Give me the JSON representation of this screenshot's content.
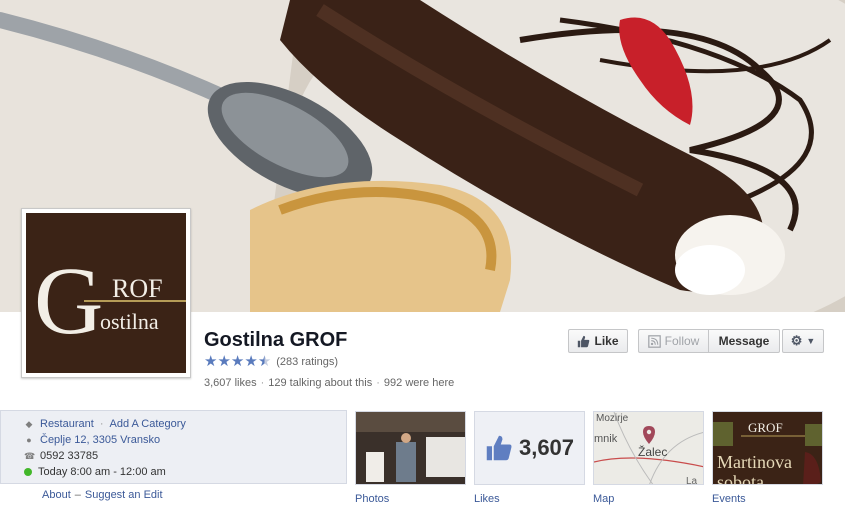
{
  "page": {
    "title": "Gostilna GROF",
    "rating_text": "(283 ratings)",
    "rating_stars": 4.5,
    "stats": {
      "likes": "3,607 likes",
      "talking": "129 talking about this",
      "were_here": "992 were here"
    }
  },
  "logo": {
    "big_letter": "G",
    "rof": "ROF",
    "sub": "ostilna"
  },
  "actions": {
    "like_label": "Like",
    "follow_label": "Follow",
    "message_label": "Message"
  },
  "info": {
    "category": "Restaurant",
    "add_category": "Add A Category",
    "address": "Čeplje 12, 3305 Vransko",
    "phone": "0592 33785",
    "hours": "Today 8:00 am - 12:00 am",
    "about_link": "About",
    "suggest_link": "Suggest an Edit"
  },
  "tiles": {
    "photos_label": "Photos",
    "likes_label": "Likes",
    "likes_count": "3,607",
    "map_label": "Map",
    "events_label": "Events",
    "map_text_1": "Mozirje",
    "map_text_2": "mnik",
    "map_text_3": "Žalec",
    "map_text_4": "La",
    "events_text_1": "GROF",
    "events_text_2": "Martinova",
    "events_text_3": "sobota"
  },
  "colors": {
    "link": "#3b5998",
    "star": "#5a7bbd",
    "logo_bg": "#3b2316",
    "logo_line": "#b69c57",
    "open_dot": "#42b72a"
  }
}
